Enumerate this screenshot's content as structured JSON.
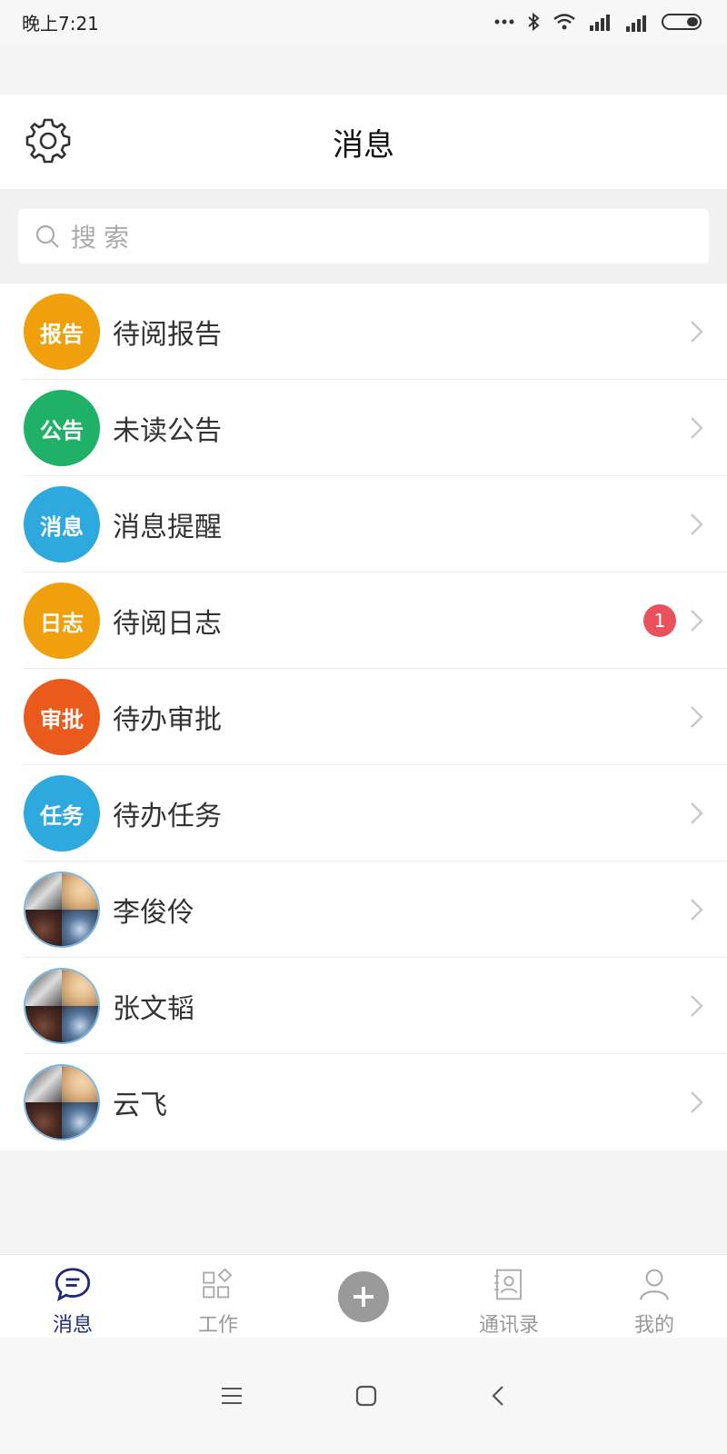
{
  "status_bar": {
    "time": "晚上7:21"
  },
  "header": {
    "title": "消息"
  },
  "search": {
    "placeholder": "搜索"
  },
  "list": [
    {
      "type": "icon",
      "icon_text": "报告",
      "color": "#f0a00c",
      "label": "待阅报告",
      "badge": ""
    },
    {
      "type": "icon",
      "icon_text": "公告",
      "color": "#1fb168",
      "label": "未读公告",
      "badge": ""
    },
    {
      "type": "icon",
      "icon_text": "消息",
      "color": "#2ea9de",
      "label": "消息提醒",
      "badge": ""
    },
    {
      "type": "icon",
      "icon_text": "日志",
      "color": "#f0a00c",
      "label": "待阅日志",
      "badge": "1"
    },
    {
      "type": "icon",
      "icon_text": "审批",
      "color": "#ea5a1c",
      "label": "待办审批",
      "badge": ""
    },
    {
      "type": "icon",
      "icon_text": "任务",
      "color": "#2ea9de",
      "label": "待办任务",
      "badge": ""
    },
    {
      "type": "photo",
      "label": "李俊伶",
      "badge": ""
    },
    {
      "type": "photo",
      "label": "张文韬",
      "badge": ""
    },
    {
      "type": "photo",
      "label": "云飞",
      "badge": ""
    }
  ],
  "tabbar": {
    "messages": "消息",
    "work": "工作",
    "contacts": "通讯录",
    "mine": "我的"
  },
  "colors": {
    "active_tab": "#1f2a7a",
    "badge": "#e9525c"
  }
}
